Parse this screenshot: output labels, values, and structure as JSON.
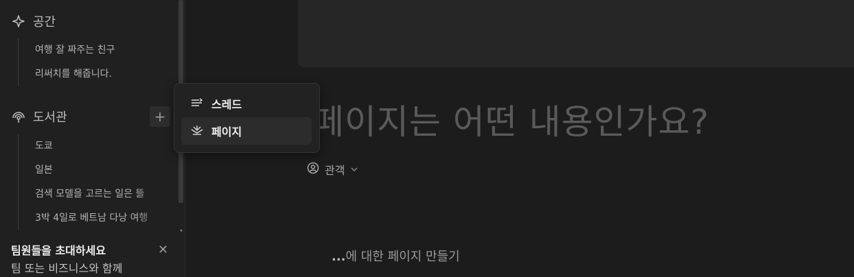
{
  "sidebar": {
    "spaces": {
      "title": "공간",
      "icon": "sparkle-icon",
      "items": [
        "여행 잘 짜주는 친구",
        "리써치를 해줍니다."
      ]
    },
    "library": {
      "title": "도서관",
      "icon": "library-icon",
      "add_label": "+",
      "items": [
        "도쿄",
        "일본",
        "검색 모델을 고르는 일은 뜰",
        "3박 4일로 베트남 다낭 여행"
      ]
    },
    "invite": {
      "title": "팀원들을 초대하세요",
      "subtitle": "팀 또는 비즈니스와 함께",
      "close": "✕"
    }
  },
  "main": {
    "title": "페이지는 어떤 내용인가요?",
    "audience_label": "관객",
    "make_page_dots": "...",
    "make_page_text": "에 대한 페이지 만들기"
  },
  "popup_menu": {
    "items": [
      {
        "label": "스레드",
        "icon": "thread-icon"
      },
      {
        "label": "페이지",
        "icon": "page-icon"
      }
    ]
  }
}
